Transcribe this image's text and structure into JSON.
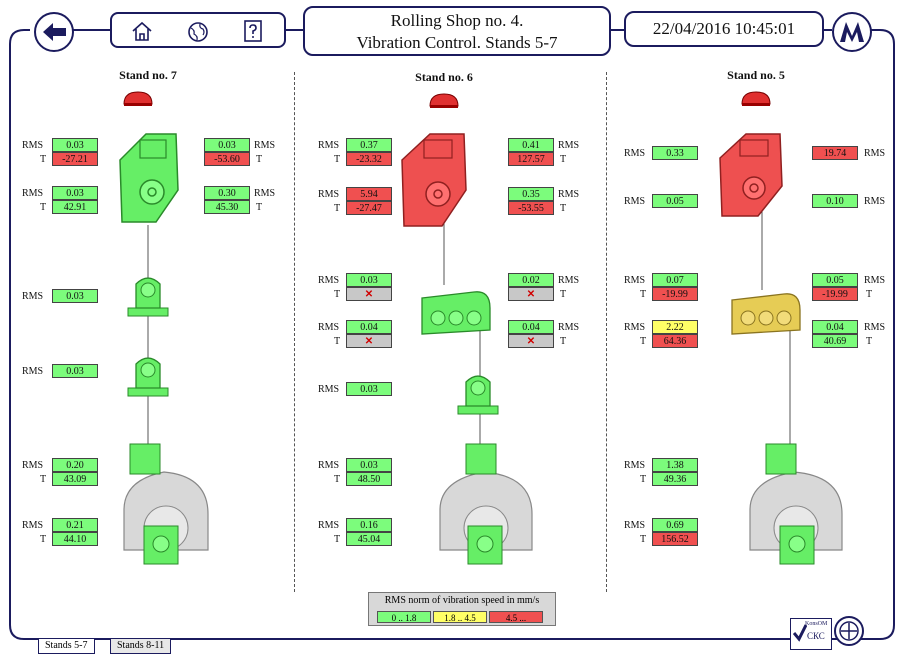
{
  "header": {
    "title_line1": "Rolling Shop no. 4.",
    "title_line2": "Vibration Control. Stands 5-7",
    "datetime": "22/04/2016 10:45:01"
  },
  "colors": {
    "ok": "#7CFC7C",
    "warn": "#FFFF66",
    "alarm": "#F05050",
    "gray": "#C8C8C8",
    "frame": "#1b1b5e"
  },
  "stands": {
    "s7": {
      "title": "Stand no. 7",
      "r1l": {
        "rms": "0.03",
        "t": "-27.21"
      },
      "r1r": {
        "rms": "0.03",
        "t": "-53.60"
      },
      "r2l": {
        "rms": "0.03",
        "t": "42.91"
      },
      "r2r": {
        "rms": "0.30",
        "t": "45.30"
      },
      "b1": {
        "rms": "0.03"
      },
      "b2": {
        "rms": "0.03"
      },
      "m1": {
        "rms": "0.20",
        "t": "43.09"
      },
      "m2": {
        "rms": "0.21",
        "t": "44.10"
      }
    },
    "s6": {
      "title": "Stand no. 6",
      "r1l": {
        "rms": "0.37",
        "t": "-23.32"
      },
      "r1r": {
        "rms": "0.41",
        "t": "127.57"
      },
      "r2l": {
        "rms": "5.94",
        "t": "-27.47"
      },
      "r2r": {
        "rms": "0.35",
        "t": "-53.55"
      },
      "g1l": {
        "rms": "0.03",
        "t": "✕"
      },
      "g1r": {
        "rms": "0.02",
        "t": "✕"
      },
      "g2l": {
        "rms": "0.04",
        "t": "✕"
      },
      "g2r": {
        "rms": "0.04",
        "t": "✕"
      },
      "b1": {
        "rms": "0.03"
      },
      "m1": {
        "rms": "0.03",
        "t": "48.50"
      },
      "m2": {
        "rms": "0.16",
        "t": "45.04"
      }
    },
    "s5": {
      "title": "Stand no. 5",
      "r1l": {
        "rms": "0.33"
      },
      "r1r": {
        "rms": "19.74"
      },
      "r2l": {
        "rms": "0.05"
      },
      "r2r": {
        "rms": "0.10"
      },
      "g1l": {
        "rms": "0.07",
        "t": "-19.99"
      },
      "g1r": {
        "rms": "0.05",
        "t": "-19.99"
      },
      "g2l": {
        "rms": "2.22",
        "t": "64.36"
      },
      "g2r": {
        "rms": "0.04",
        "t": "40.69"
      },
      "m1": {
        "rms": "1.38",
        "t": "49.36"
      },
      "m2": {
        "rms": "0.69",
        "t": "156.52"
      }
    }
  },
  "labels": {
    "rms": "RMS",
    "t": "T"
  },
  "legend": {
    "title": "RMS norm of vibration speed in mm/s",
    "ok": "0 .. 1.8",
    "warn": "1.8 .. 4.5",
    "alarm": "4.5 ..."
  },
  "tabs": {
    "t1": "Stands 5-7",
    "t2": "Stands 8-11"
  },
  "logo": {
    "line1": "KonsOM",
    "line2": "СКС"
  }
}
